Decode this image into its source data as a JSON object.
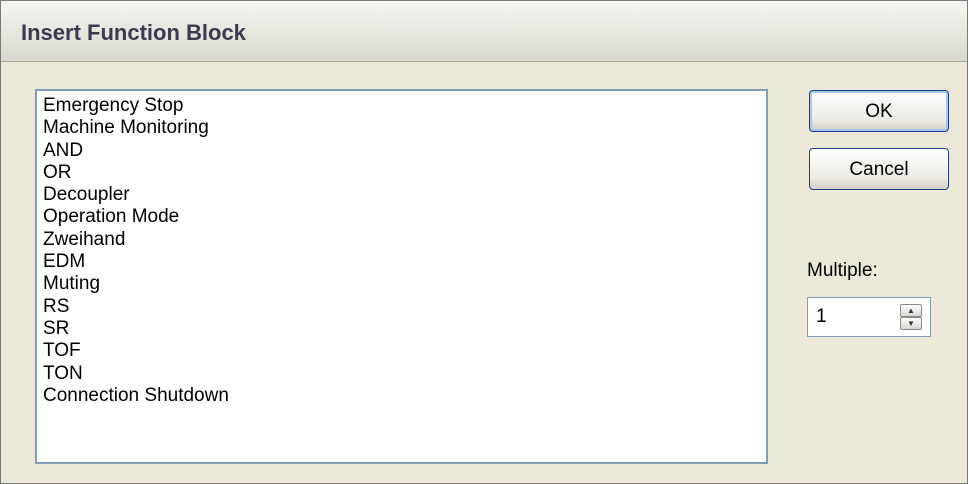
{
  "window": {
    "title": "Insert Function Block"
  },
  "list": {
    "items": [
      "Emergency Stop",
      "Machine Monitoring",
      "AND",
      "OR",
      "Decoupler",
      "Operation Mode",
      "Zweihand",
      "EDM",
      "Muting",
      "RS",
      "SR",
      "TOF",
      "TON",
      "Connection Shutdown"
    ]
  },
  "buttons": {
    "ok": "OK",
    "cancel": "Cancel"
  },
  "multiple": {
    "label": "Multiple:",
    "value": "1"
  },
  "icons": {
    "spin_up": "up-arrow-icon",
    "spin_down": "down-arrow-icon"
  }
}
